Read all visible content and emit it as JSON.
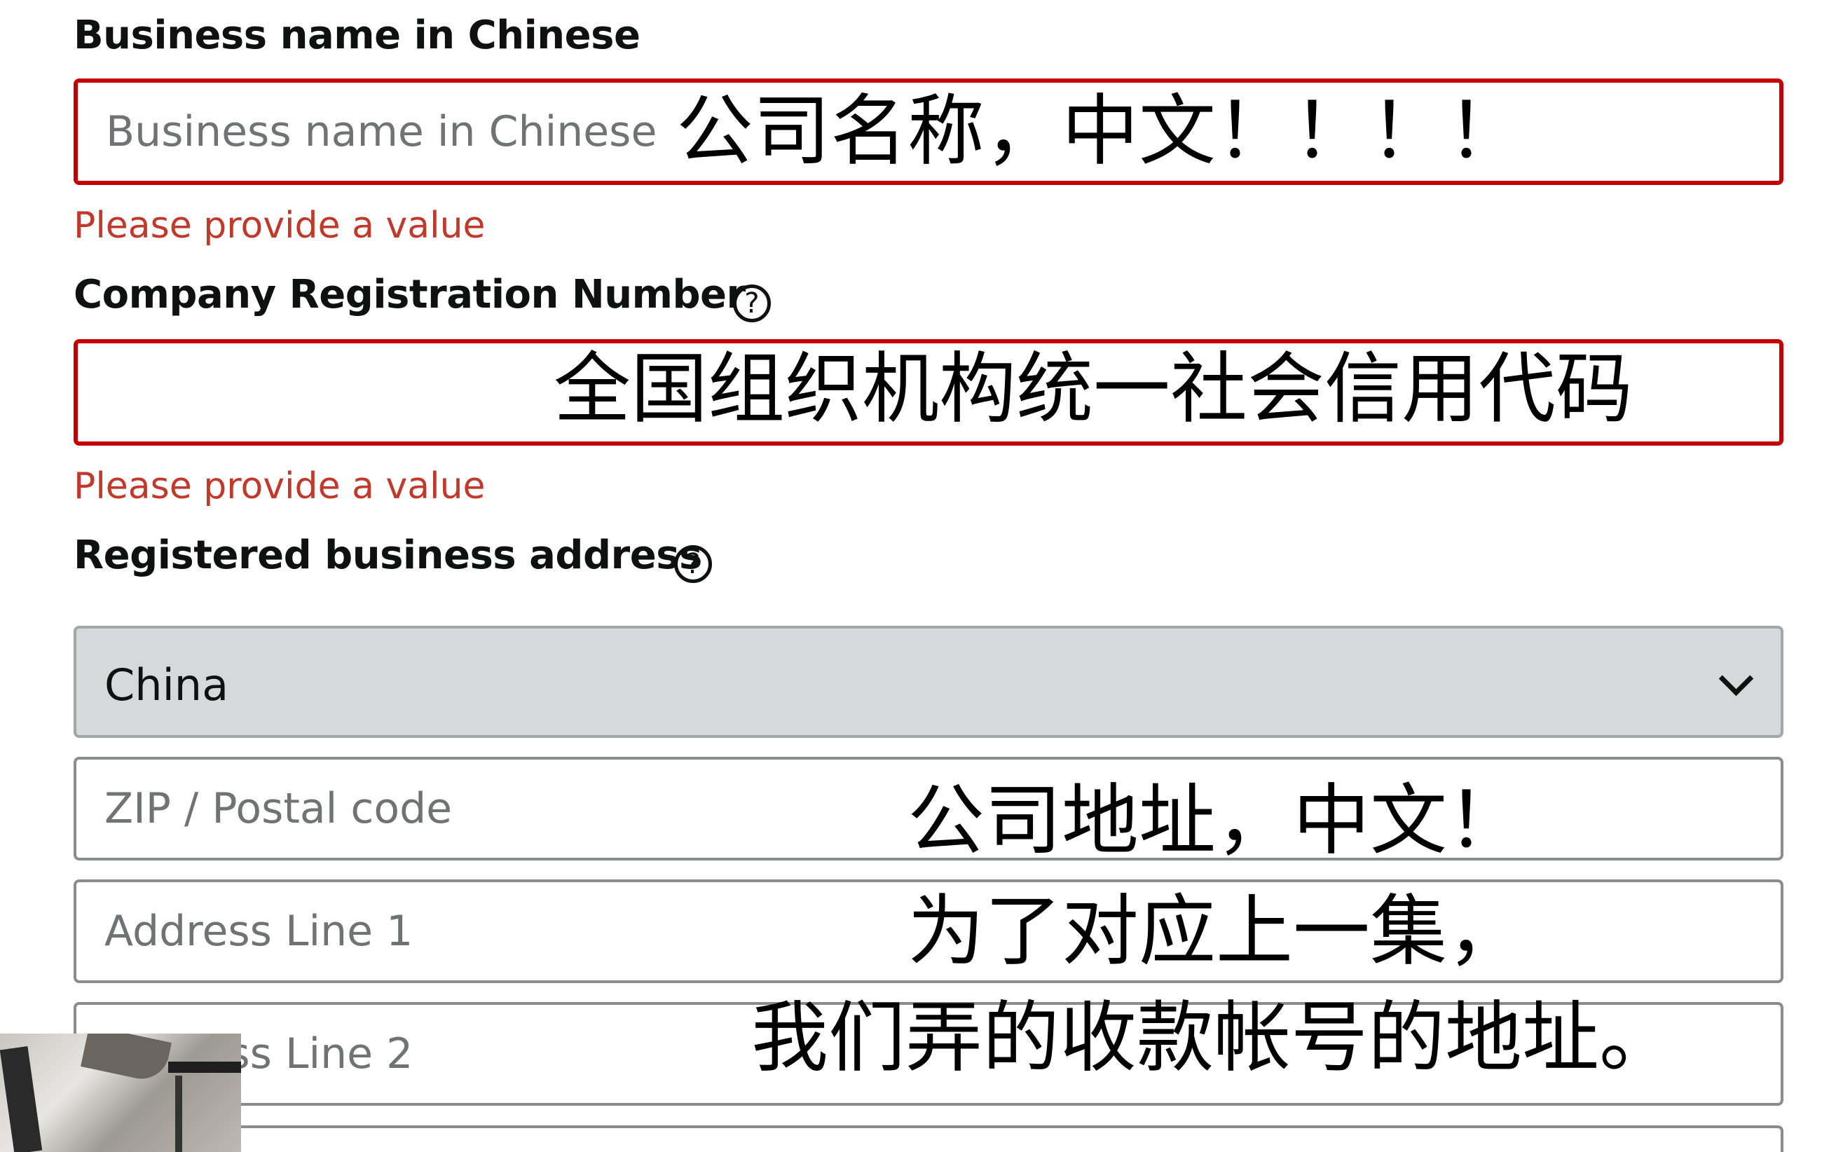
{
  "business_name_cn": {
    "label": "Business name in Chinese",
    "placeholder": "Business name in Chinese",
    "value": "",
    "error": "Please provide a value"
  },
  "registration_number": {
    "label": "Company Registration Number",
    "help_icon": "?",
    "value": "",
    "error": "Please provide a value"
  },
  "address": {
    "label": "Registered business address",
    "help_icon": "?",
    "country": "China",
    "zip_placeholder": "ZIP / Postal code",
    "line1_placeholder": "Address Line 1",
    "line2_placeholder": "Address Line 2"
  },
  "subtitles": {
    "line_business_name": "公司名称，中文！！！！",
    "line_registration": "全国组织机构统一社会信用代码",
    "line_address_1": "公司地址，中文！",
    "line_address_2": "为了对应上一集，",
    "line_address_3": "我们弄的收款帐号的地址。"
  },
  "colors": {
    "error_border": "#c40000",
    "error_text": "#c0392b",
    "select_bg": "#d5d9d9"
  }
}
